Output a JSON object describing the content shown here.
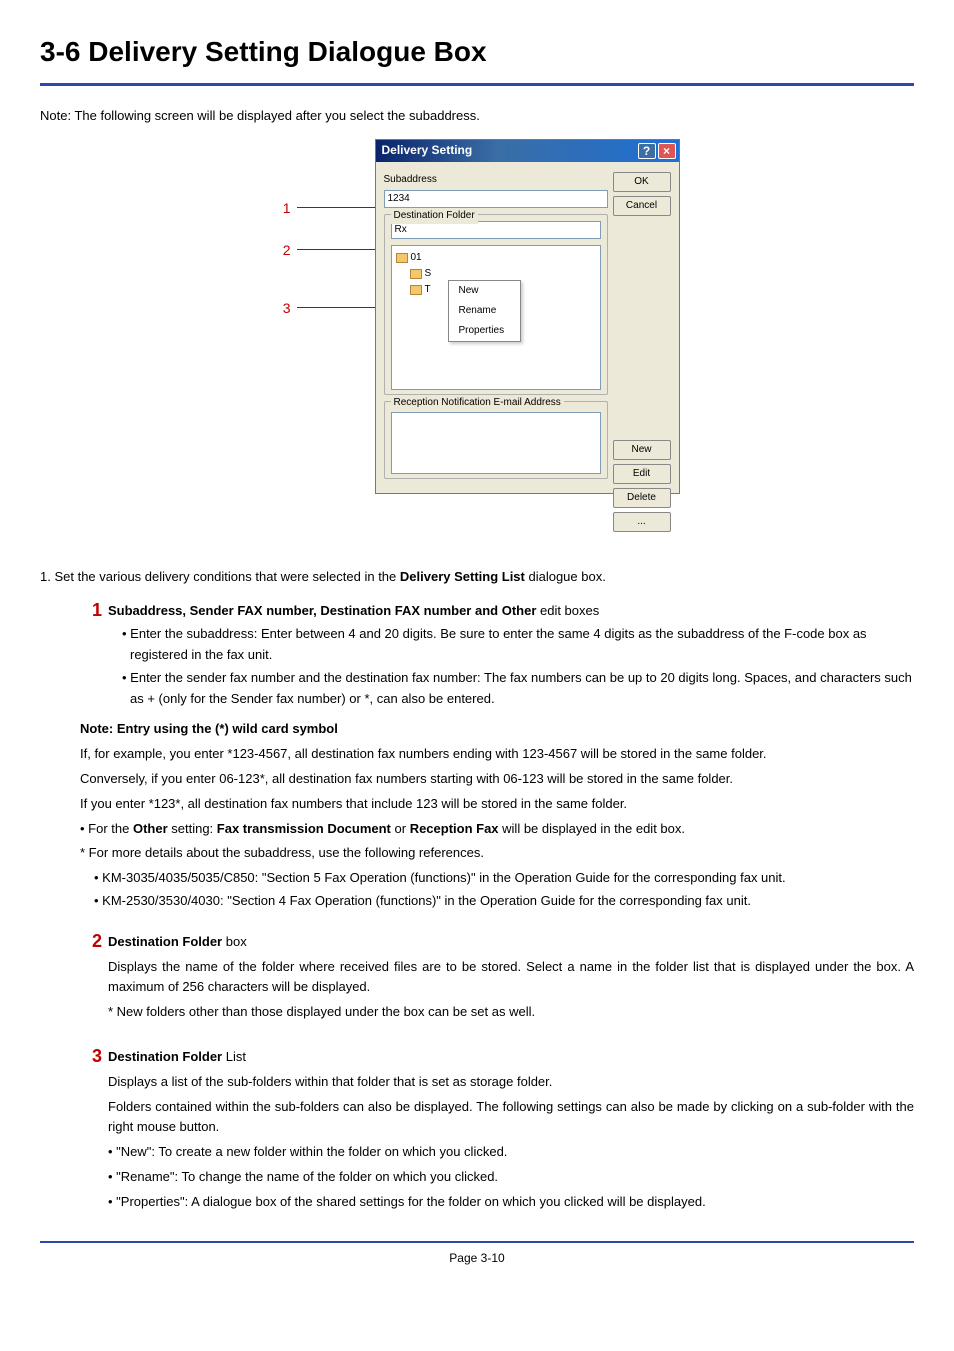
{
  "page": {
    "title": "3-6  Delivery Setting Dialogue Box",
    "note_prefix": "Note: ",
    "note_body": "The following screen will be displayed after you select the subaddress.",
    "footer": "Page 3-10"
  },
  "callouts": {
    "c1": "1",
    "c2": "2",
    "c3": "3"
  },
  "dialog": {
    "title": "Delivery Setting",
    "help": "?",
    "close": "×",
    "subaddress_label": "Subaddress",
    "subaddress_value": "1234",
    "dest_folder_legend": "Destination Folder",
    "dest_folder_value": "Rx",
    "tree": {
      "root": "01",
      "sub1": "S",
      "sub2": "T"
    },
    "ctx": {
      "new": "New",
      "rename": "Rename",
      "properties": "Properties"
    },
    "email_legend": "Reception Notification E-mail Address",
    "buttons": {
      "ok": "OK",
      "cancel": "Cancel",
      "new": "New",
      "edit": "Edit",
      "delete": "Delete",
      "more": "..."
    }
  },
  "intro": {
    "num": "1.",
    "text_before": "Set the various delivery conditions that were selected in the ",
    "bold": "Delivery Setting List",
    "text_after": " dialogue box."
  },
  "sec1": {
    "num": "1",
    "title_b1": "Subaddress, Sender FAX number, Destination FAX number",
    "title_mid": " and ",
    "title_b2": "Other",
    "title_end": " edit boxes",
    "bullet1": "• Enter the subaddress: Enter between 4 and 20 digits. Be sure to enter the same 4 digits as the subaddress of the F-code box as registered in the fax unit.",
    "bullet2": "• Enter the sender fax number and the destination fax number: The fax numbers can be up to 20 digits long. Spaces, and characters such as + (only for the Sender fax number) or *, can also be entered.",
    "note_title": "Note: Entry using the (*) wild card symbol",
    "wild1": "If, for example, you enter *123-4567, all destination fax numbers ending with 123-4567 will be stored in the same folder.",
    "wild2": "Conversely, if you enter 06-123*, all destination fax numbers starting with 06-123 will be stored in the same folder.",
    "wild3": "If you enter *123*, all destination fax numbers that include 123 will be stored in the same folder.",
    "other_pre": "• For the ",
    "other_b1": "Other",
    "other_mid": " setting: ",
    "other_b2": "Fax transmission Document",
    "other_or": " or ",
    "other_b3": "Reception Fax",
    "other_end": " will be displayed in the edit box.",
    "ref_head": "* For more details about the subaddress, use the following references.",
    "ref1": "• KM-3035/4035/5035/C850: \"Section 5  Fax Operation (functions)\" in the Operation Guide for the corresponding fax unit.",
    "ref2": "• KM-2530/3530/4030: \"Section 4  Fax Operation (functions)\" in the Operation Guide for the corresponding fax unit."
  },
  "sec2": {
    "num": "2",
    "title_b": "Destination Folder",
    "title_end": " box",
    "p1": "Displays the name of the folder where received files are to be stored. Select a name in the folder list that is displayed under the box. A maximum of 256 characters will be displayed.",
    "p2": "* New folders other than those displayed under the box can be set as well."
  },
  "sec3": {
    "num": "3",
    "title_b": "Destination Folder",
    "title_end": " List",
    "p1": "Displays a list of the sub-folders within that folder that is set as storage folder.",
    "p2": "Folders contained within the sub-folders can also be displayed. The following settings can also be made by clicking on a sub-folder with the right mouse button.",
    "b1": "• \"New\": To create a new folder within the folder on which you clicked.",
    "b2": "• \"Rename\": To change the name of the folder on which you clicked.",
    "b3": "• \"Properties\": A dialogue box of the shared settings for the folder on which you clicked will be displayed."
  }
}
